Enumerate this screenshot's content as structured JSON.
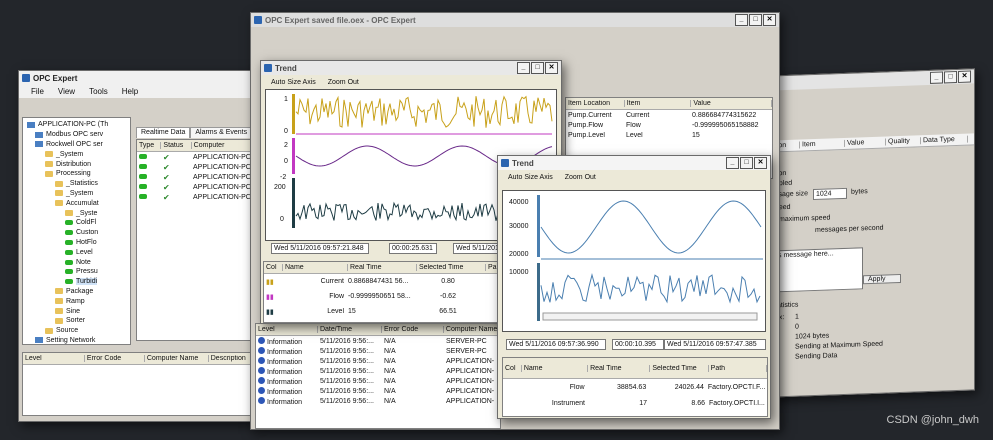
{
  "watermark": "CSDN @john_dwh",
  "left_window": {
    "title": "OPC Expert",
    "menu": [
      "File",
      "View",
      "Tools",
      "Help"
    ],
    "tree": [
      "APPLICATION-PC (Th",
      "Modbus OPC serv",
      "Rockwell OPC ser",
      "_System",
      "Distribution",
      "Processing",
      "_Statistics",
      "_System",
      "Accumulat",
      "_Syste",
      "ColdFl",
      "Custon",
      "HotFlo",
      "Level",
      "Note",
      "Pressu",
      "Turbidi",
      "Package",
      "Ramp",
      "Sine",
      "Sorter",
      "Source",
      "Setting Network"
    ],
    "tabs": [
      "Realtime Data",
      "Alarms & Events"
    ],
    "grid_headers": [
      "Type",
      "Status",
      "Computer"
    ],
    "grid_rows": [
      "APPLICATION-PC",
      "APPLICATION-PC",
      "APPLICATION-PC",
      "APPLICATION-PC",
      "APPLICATION-PC"
    ],
    "bottom_headers": [
      "Level",
      "Error Code",
      "Computer Name",
      "Description"
    ]
  },
  "center_window": {
    "title": "OPC Expert saved file.oex - OPC Expert",
    "trend_title": "Trend",
    "toolbar": [
      "Auto Size Axis",
      "Zoom Out"
    ],
    "axis_labels": [
      "1",
      "0",
      "2",
      "0",
      "-2",
      "200",
      "0"
    ],
    "time_boxes": [
      "Wed 5/11/2016 09:57:21.848",
      "00:00:25.631",
      "Wed 5/11/201"
    ],
    "item_headers": [
      "Item Location",
      "Item",
      "Value"
    ],
    "items": [
      [
        "Pump.Current",
        "Current",
        "0.886684774315622"
      ],
      [
        "Pump.Flow",
        "Flow",
        "-0.999995065158882"
      ],
      [
        "Pump.Level",
        "Level",
        "15"
      ]
    ],
    "grid_headers": [
      "Col",
      "Name",
      "Real Time",
      "Selected Time",
      "Pa"
    ],
    "grid_rows": [
      [
        "Current",
        "0.8868847431 56...",
        "0.80"
      ],
      [
        "Flow",
        "-0.9999950651 58...",
        "-0.62"
      ],
      [
        "Level",
        "15",
        "66.51"
      ]
    ],
    "log_headers": [
      "Level",
      "Date/Time",
      "Error Code",
      "Computer Name"
    ],
    "log_rows": [
      [
        "Information",
        "5/11/2016 9:56:...",
        "N/A",
        "SERVER-PC"
      ],
      [
        "Information",
        "5/11/2016 9:56:...",
        "N/A",
        "SERVER-PC"
      ],
      [
        "Information",
        "5/11/2016 9:56:...",
        "N/A",
        "APPLICATION-"
      ],
      [
        "Information",
        "5/11/2016 9:56:...",
        "N/A",
        "APPLICATION-"
      ],
      [
        "Information",
        "5/11/2016 9:56:...",
        "N/A",
        "APPLICATION-"
      ],
      [
        "Information",
        "5/11/2016 9:56:...",
        "N/A",
        "APPLICATION-"
      ],
      [
        "Information",
        "5/11/2016 9:56:...",
        "N/A",
        "APPLICATION-"
      ]
    ]
  },
  "front_trend": {
    "title": "Trend",
    "toolbar": [
      "Auto Size Axis",
      "Zoom Out"
    ],
    "y_ticks": [
      "40000",
      "30000",
      "20000",
      "10000"
    ],
    "time_boxes": [
      "Wed 5/11/2016 09:57:36.990",
      "00:00:10.395",
      "Wed 5/11/2016 09:57:47.385"
    ],
    "grid_headers": [
      "Col",
      "Name",
      "Real Time",
      "Selected Time",
      "Path"
    ],
    "grid_rows": [
      [
        "Flow",
        "38854.63",
        "24026.44",
        "Factory.OPCTI.F..."
      ],
      [
        "Instrument",
        "17",
        "8.66",
        "Factory.OPCTI.I..."
      ]
    ]
  },
  "right_window": {
    "headers": [
      "ation",
      "Item",
      "Value",
      "Quality",
      "Data Type"
    ],
    "labels": [
      "tion",
      "abled",
      "ssage size",
      "bytes",
      "peed",
      "maximum speed",
      "messages per second",
      "s message here...",
      "Apply",
      "tatistics",
      "ex:",
      "1",
      "0",
      "1024 bytes",
      "Sending at Maximum Speed",
      "Sending Data"
    ],
    "size_value": "1024"
  },
  "colors": {
    "yellow": "#c8a11a",
    "magenta": "#c238c2",
    "purple": "#6a2a8a",
    "dark": "#1e3c44",
    "blue": "#4a7fb0"
  }
}
